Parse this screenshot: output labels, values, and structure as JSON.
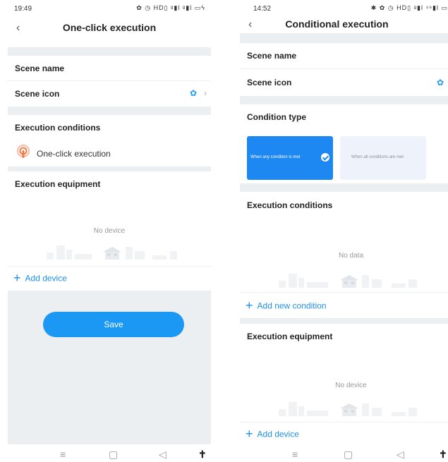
{
  "left": {
    "status": {
      "time": "19:49",
      "icons": "✿ ◷ HD▯ ᵍ▮l ᵍ▮l ▭ϟ"
    },
    "titlebar": {
      "back": "‹",
      "title": "One-click execution"
    },
    "scene_name_label": "Scene name",
    "scene_icon_label": "Scene icon",
    "execution_conditions_label": "Execution conditions",
    "condition_item": "One-click execution",
    "execution_equipment_label": "Execution equipment",
    "empty_text": "No device",
    "add_device": "Add device",
    "save": "Save",
    "nav": {
      "menu": "≡",
      "home": "▢",
      "back": "◁",
      "accessibility": "✝"
    }
  },
  "right": {
    "status": {
      "time": "14:52",
      "icons": "✱ ✿ ◷ HD▯ ᵍ▮l ⁴⁶▮l ▭"
    },
    "titlebar": {
      "back": "‹",
      "title": "Conditional execution"
    },
    "scene_name_label": "Scene name",
    "scene_icon_label": "Scene icon",
    "condition_type_label": "Condition type",
    "condition_any": "When any condition is met",
    "condition_all": "When all conditions are met",
    "execution_conditions_label": "Execution conditions",
    "empty_conditions": "No data",
    "add_condition": "Add new condition",
    "execution_equipment_label": "Execution equipment",
    "empty_equipment": "No device",
    "add_device": "Add device",
    "nav": {
      "menu": "≡",
      "home": "▢",
      "back": "◁",
      "accessibility": "✝"
    }
  },
  "colors": {
    "accent": "#1a98f4",
    "section_gap": "#eceff1",
    "condition_icon": "#f07a4a"
  }
}
